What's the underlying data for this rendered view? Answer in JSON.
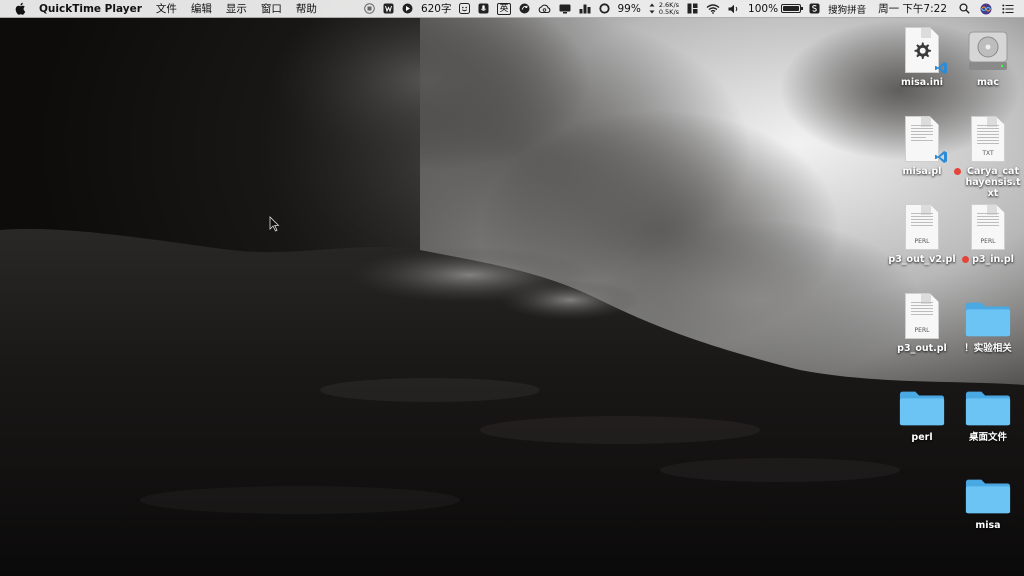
{
  "menubar": {
    "app_name": "QuickTime Player",
    "menus": [
      "文件",
      "编辑",
      "显示",
      "窗口",
      "帮助"
    ],
    "word_count": "620字",
    "ime_label": "英",
    "cpu_percent": "99%",
    "net_up": "2.6K/s",
    "net_down": "0.5K/s",
    "battery_percent": "100%",
    "input_method": "搜狗拼音",
    "datetime": "周一 下午7:22",
    "battery_level": 1.0
  },
  "desktop_icons": [
    {
      "label": "misa.ini",
      "type": "ini"
    },
    {
      "label": "mac",
      "type": "drive"
    },
    {
      "label": "misa.pl",
      "type": "vscode-doc"
    },
    {
      "label": "Carya_cathayensis.txt",
      "type": "txt",
      "tag": "red"
    },
    {
      "label": "p3_out_v2.pl",
      "type": "perl"
    },
    {
      "label": "p3_in.pl",
      "type": "perl",
      "tag": "red"
    },
    {
      "label": "p3_out.pl",
      "type": "perl"
    },
    {
      "label": "！实验相关",
      "type": "folder"
    },
    {
      "label": "perl",
      "type": "folder"
    },
    {
      "label": "桌面文件",
      "type": "folder"
    },
    {
      "label": "misa",
      "type": "folder"
    }
  ],
  "doc_tags": {
    "perl": "PERL",
    "txt": "TXT"
  },
  "colors": {
    "folder": "#5ab8ee",
    "tag_red": "#e5443b",
    "vscode_blue": "#2a8bd8"
  }
}
